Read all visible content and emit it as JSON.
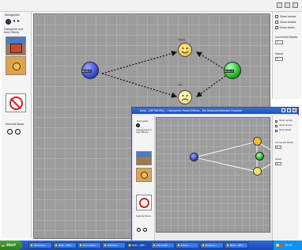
{
  "left_panel": {
    "navigation_label": "Navigation",
    "categories_label": "Categories and their Effects",
    "selection_label": "Selected Node"
  },
  "right_panel": {
    "checkboxes": [
      "Show names",
      "Show arrows",
      "Show labels"
    ],
    "node_count_label": "Connected Nodes",
    "node_count_value": "1",
    "speed_label": "Speed",
    "speed_value": "5"
  },
  "graph": {
    "center_node_label": "Node 1",
    "right_node_label": "Node 2",
    "top_face_label": "happy",
    "bottom_face_label": "sad"
  },
  "inner_window": {
    "title": "Nets - [NETWORK]  -  Categories Panel Effects - My Network/Network Explorer",
    "left_labels": [
      "Navigation",
      "Categories and their Effects",
      "Selected Node"
    ],
    "right_checkboxes": [
      "Show names",
      "Show arrows",
      "Show labels"
    ],
    "node_count_label": "Connected Nodes",
    "node_count_value": "1",
    "speed_label": "Speed",
    "speed_value": "5"
  },
  "taskbar": {
    "start_label": "Start",
    "items": [
      "Windows...",
      "Nets - NET...",
      "Document...",
      "Untitled...",
      "Nets - NET...",
      "Microsoft...",
      "Inbox...",
      "Explorer...",
      "Nets - NET..."
    ],
    "clock": "10:43"
  },
  "colors": {
    "canvas_bg": "#9c9c9c",
    "grid_line": "#adadad",
    "center_node": "#3b4bd1",
    "right_node": "#28b72c",
    "face": "#f3d43a",
    "taskbar": "#2457c6",
    "start_button": "#3a9a2f"
  }
}
